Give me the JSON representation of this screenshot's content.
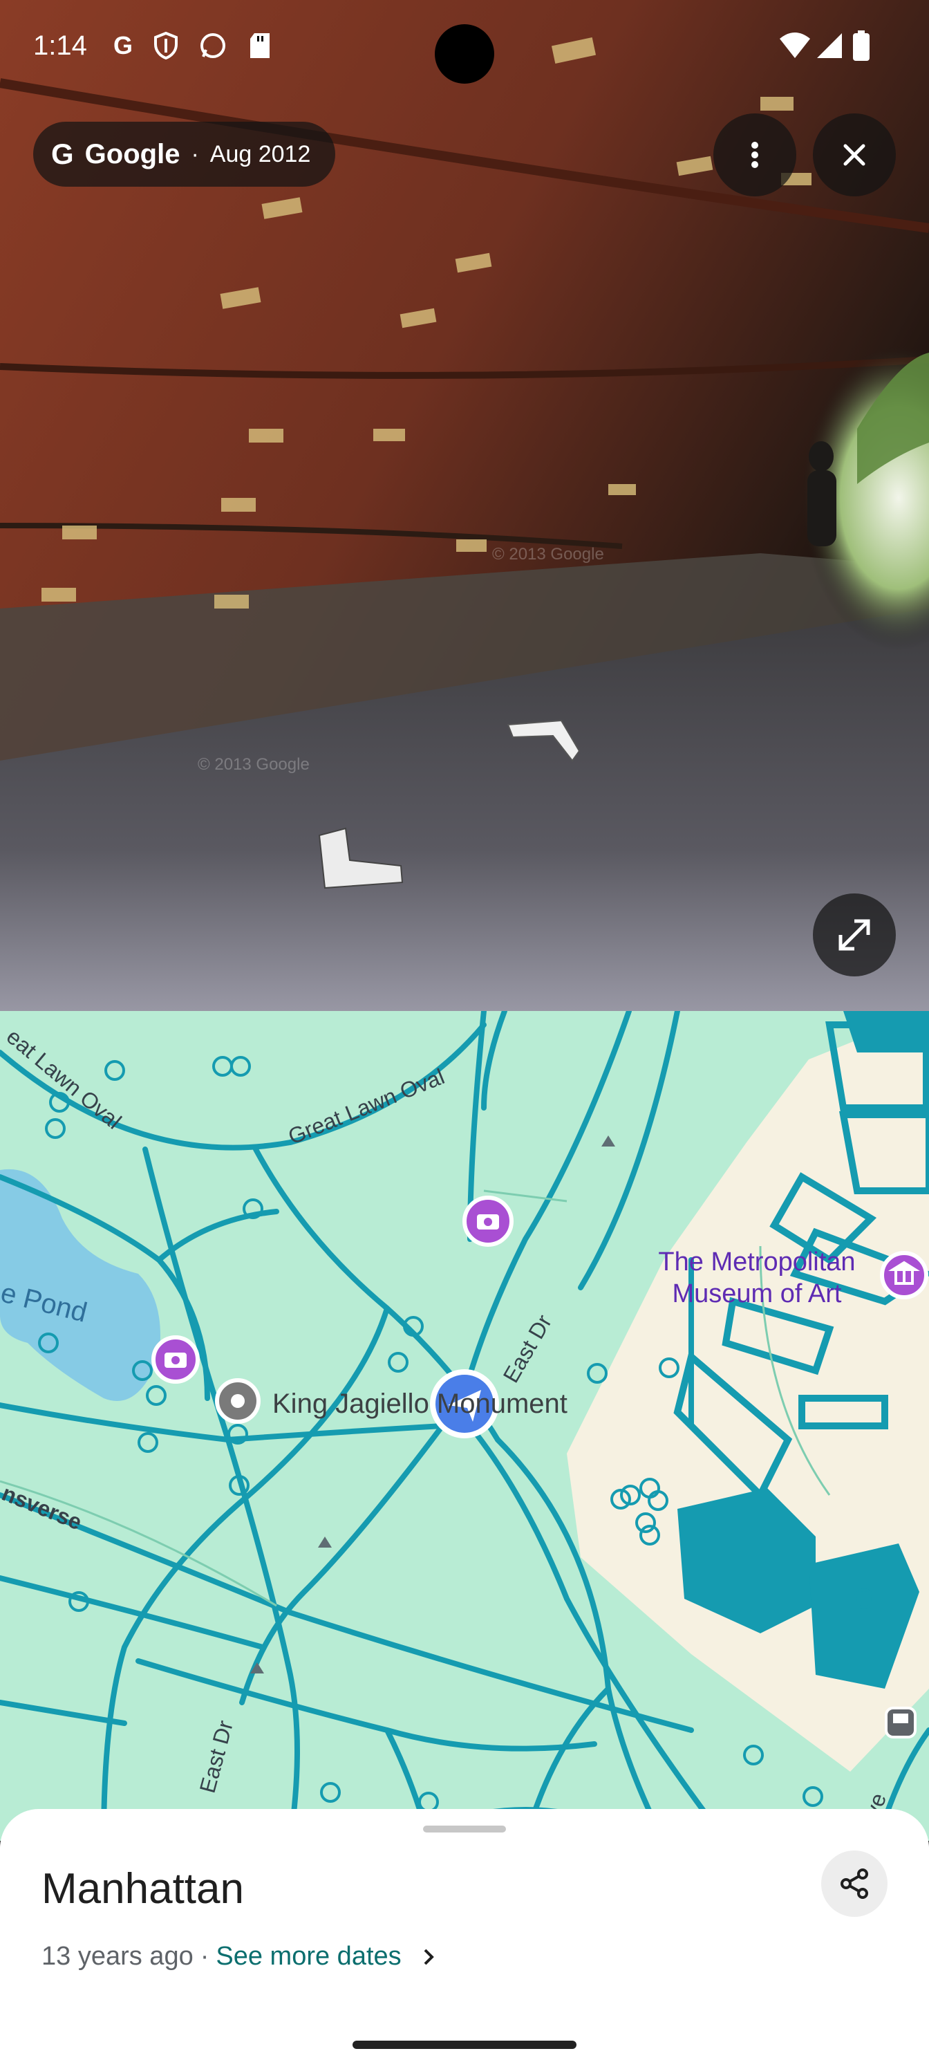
{
  "status_bar": {
    "time": "1:14",
    "icons": [
      "google-icon",
      "vpn-shield-icon",
      "whatsapp-icon",
      "sd-card-icon"
    ],
    "right_icons": [
      "wifi-icon",
      "signal-icon",
      "battery-icon"
    ]
  },
  "street_view": {
    "provider": "Google",
    "date_sep": "·",
    "date": "Aug 2012",
    "watermark": "© 2013 Google",
    "watermark2": "© 2013 Google"
  },
  "map": {
    "labels": {
      "great_lawn_oval_a": "Great Lawn Oval",
      "great_lawn_oval_b": "eat Lawn Oval",
      "pond": "e Pond",
      "museum": "The Metropolitan\nMuseum of Art",
      "monument": "King Jagiello Monument",
      "east_dr_a": "East Dr",
      "east_dr_b": "East Dr",
      "transverse": "nsverse",
      "ave": "ve"
    }
  },
  "sheet": {
    "title": "Manhattan",
    "age": "13 years ago",
    "sep": "·",
    "link": "See more dates"
  },
  "colors": {
    "map_bg": "#b8ecd4",
    "path": "#159bb0",
    "building": "#f6f1e1",
    "water": "#86cbe5",
    "accent_link": "#0b6e6e",
    "poi_purple": "#a94fd3"
  }
}
